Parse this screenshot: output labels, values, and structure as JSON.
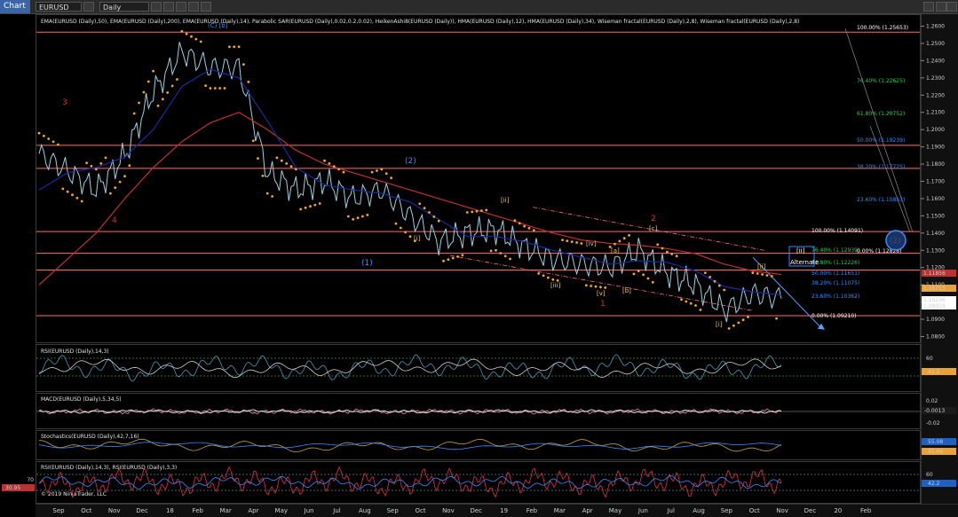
{
  "toolbar": {
    "title": "Chart",
    "instrument": "EURUSD",
    "timeframe": "Daily"
  },
  "panels": {
    "price": {
      "legend": "EMA(EURUSD (Daily),50), EMA(EURUSD (Daily),200), EMA(EURUSD (Daily),14), Parabolic SAR(EURUSD (Daily),0.02,0.2,0.02), HeikenAshi8(EURUSD (Daily)), HMA(EURUSD (Daily),12), HMA(EURUSD (Daily),34), Wiseman fractal(EURUSD (Daily),2,8), Wiseman fractal(EURUSD (Daily),2,8)",
      "ticks": [
        "1.2600",
        "1.2500",
        "1.2400",
        "1.2300",
        "1.2200",
        "1.2100",
        "1.2000",
        "1.1900",
        "1.1800",
        "1.1700",
        "1.1600",
        "1.1500",
        "1.1400",
        "1.1300",
        "1.1200",
        "1.1100",
        "1.1000",
        "1.0900",
        "1.0800"
      ],
      "badges": [
        {
          "value": "1.11856",
          "color": "#b83232"
        },
        {
          "value": "1.10713",
          "color": "#e8a23a"
        },
        {
          "value": "1.10236",
          "color": "#ffffff"
        },
        {
          "value": "1.09919",
          "color": "#ffffff"
        }
      ]
    },
    "rsi": {
      "legend": "RSI(EURUSD (Daily),14,3)",
      "ticks": [
        "60",
        "40"
      ],
      "badge": "42.2"
    },
    "macd": {
      "legend": "MACD(EURUSD (Daily),5,34,5)",
      "ticks": [
        "0.02",
        "-0.02"
      ],
      "badge": "-0.0013"
    },
    "stoch": {
      "legend": "Stochastics(EURUSD (Daily),42,7,16)",
      "badges": [
        "55.08",
        "31.66"
      ]
    },
    "rsi2": {
      "legend": "RSI(EURUSD (Daily),14,3), RSI(EURUSD (Daily),3,3)",
      "ticks": [
        "60",
        "40"
      ],
      "badge": "42.2",
      "left_top": "70",
      "left_badge": "30.95"
    }
  },
  "copyright": "© 2019 NinjaTrader, LLC",
  "fib_left": [
    {
      "label": "100.00% (1.25653)",
      "color": "#ffffff"
    },
    {
      "label": "76.40% (1.22625)",
      "color": "#33cc55"
    },
    {
      "label": "61.80% (1.20752)",
      "color": "#33cc55"
    },
    {
      "label": "50.00% (1.19239)",
      "color": "#3a8cff"
    },
    {
      "label": "38.20% (1.17725)",
      "color": "#3a8cff"
    },
    {
      "label": "23.60% (1.15853)",
      "color": "#3a8cff"
    },
    {
      "label": "0.00% (1.12828)",
      "color": "#ffffff"
    }
  ],
  "fib_right": [
    {
      "label": "100.00% (1.14091)",
      "color": "#ffffff"
    },
    {
      "label": "76.40% (1.12939)",
      "color": "#33cc55"
    },
    {
      "label": "61.80% (1.12226)",
      "color": "#33cc55"
    },
    {
      "label": "50.00% (1.11651)",
      "color": "#3a8cff"
    },
    {
      "label": "38.20% (1.11075)",
      "color": "#3a8cff"
    },
    {
      "label": "23.60% (1.10362)",
      "color": "#3a8cff"
    },
    {
      "label": "0.00% (1.09210)",
      "color": "#ffffff"
    }
  ],
  "wave_labels": [
    {
      "text": "(C) [b]",
      "color": "#3a8cff"
    },
    {
      "text": "3",
      "color": "#e03030"
    },
    {
      "text": "4",
      "color": "#e03030"
    },
    {
      "text": "(2)",
      "color": "#3a8cff"
    },
    {
      "text": "(1)",
      "color": "#3a8cff"
    },
    {
      "text": "[i]",
      "color": "#f2c94c"
    },
    {
      "text": "[ii]",
      "color": "#f2c94c"
    },
    {
      "text": "[iii]",
      "color": "#f2c94c"
    },
    {
      "text": "[iv]",
      "color": "#f2c94c"
    },
    {
      "text": "[v]",
      "color": "#f2c94c"
    },
    {
      "text": "1",
      "color": "#e03030"
    },
    {
      "text": "[a]",
      "color": "#f2c94c"
    },
    {
      "text": "[b]",
      "color": "#f2c94c"
    },
    {
      "text": "[c]",
      "color": "#f2c94c"
    },
    {
      "text": "2",
      "color": "#e03030"
    },
    {
      "text": "[i]",
      "color": "#f2c94c"
    },
    {
      "text": "[ii]",
      "color": "#f2c94c"
    },
    {
      "text": "(2)",
      "color": "#3a8cff"
    },
    {
      "text": "[ii]",
      "color": "#ffffff"
    },
    {
      "text": "Alternate",
      "color": "#ffffff"
    }
  ],
  "date_axis": [
    "Sep",
    "Oct",
    "Nov",
    "Dec",
    "18",
    "Feb",
    "Mar",
    "Apr",
    "May",
    "Jun",
    "Jul",
    "Aug",
    "Sep",
    "Oct",
    "Nov",
    "Dec",
    "19",
    "Feb",
    "Mar",
    "Apr",
    "May",
    "Jun",
    "Jul",
    "Aug",
    "Sep",
    "Oct",
    "Nov",
    "Dec",
    "20",
    "Feb"
  ],
  "chart_data": {
    "type": "line",
    "title": "",
    "instrument": "EURUSD",
    "timeframe": "Daily",
    "ylim": [
      1.08,
      1.265
    ],
    "x": [
      "Sep",
      "Oct",
      "Nov",
      "Dec",
      "18",
      "Feb",
      "Mar",
      "Apr",
      "May",
      "Jun",
      "Jul",
      "Aug",
      "Sep",
      "Oct",
      "Nov",
      "Dec",
      "19",
      "Feb",
      "Mar",
      "Apr",
      "May",
      "Jun",
      "Jul",
      "Aug",
      "Sep",
      "Oct",
      "Nov"
    ],
    "series": [
      {
        "name": "EURUSD",
        "color": "#9fd0e0",
        "values": [
          1.186,
          1.176,
          1.165,
          1.185,
          1.222,
          1.245,
          1.236,
          1.236,
          1.175,
          1.165,
          1.17,
          1.16,
          1.165,
          1.15,
          1.135,
          1.14,
          1.142,
          1.132,
          1.125,
          1.122,
          1.12,
          1.13,
          1.117,
          1.11,
          1.095,
          1.105,
          1.102
        ]
      },
      {
        "name": "EMA(EURUSD (Daily),200)",
        "color": "#c03030",
        "values": [
          1.11,
          1.125,
          1.14,
          1.16,
          1.178,
          1.193,
          1.204,
          1.21,
          1.2,
          1.188,
          1.18,
          1.175,
          1.17,
          1.165,
          1.16,
          1.155,
          1.15,
          1.145,
          1.14,
          1.136,
          1.134,
          1.133,
          1.131,
          1.128,
          1.122,
          1.118,
          1.116
        ]
      },
      {
        "name": "EMA(EURUSD (Daily),50)",
        "color": "#1a2aa0",
        "values": [
          1.165,
          1.175,
          1.178,
          1.184,
          1.2,
          1.225,
          1.235,
          1.23,
          1.205,
          1.178,
          1.168,
          1.165,
          1.163,
          1.158,
          1.148,
          1.138,
          1.138,
          1.135,
          1.13,
          1.126,
          1.122,
          1.124,
          1.123,
          1.118,
          1.109,
          1.106,
          1.104
        ]
      }
    ],
    "horizontal_levels": [
      1.2565,
      1.1909,
      1.1775,
      1.1409,
      1.1283,
      1.1186,
      1.0921
    ],
    "horizontal_level_color": "#ff6b6b",
    "rsi": {
      "ylim": [
        20,
        80
      ],
      "levels": [
        60,
        40
      ],
      "last": 42.2
    },
    "macd": {
      "ylim": [
        -0.03,
        0.03
      ],
      "levels": [
        0.02,
        -0.02
      ],
      "last": -0.0013
    },
    "stochastics": {
      "ylim": [
        0,
        100
      ],
      "last_d": 55.08,
      "last_k": 31.66
    },
    "rsi2": {
      "ylim": [
        0,
        100
      ],
      "levels": [
        70,
        30
      ],
      "last": 42.2
    }
  }
}
